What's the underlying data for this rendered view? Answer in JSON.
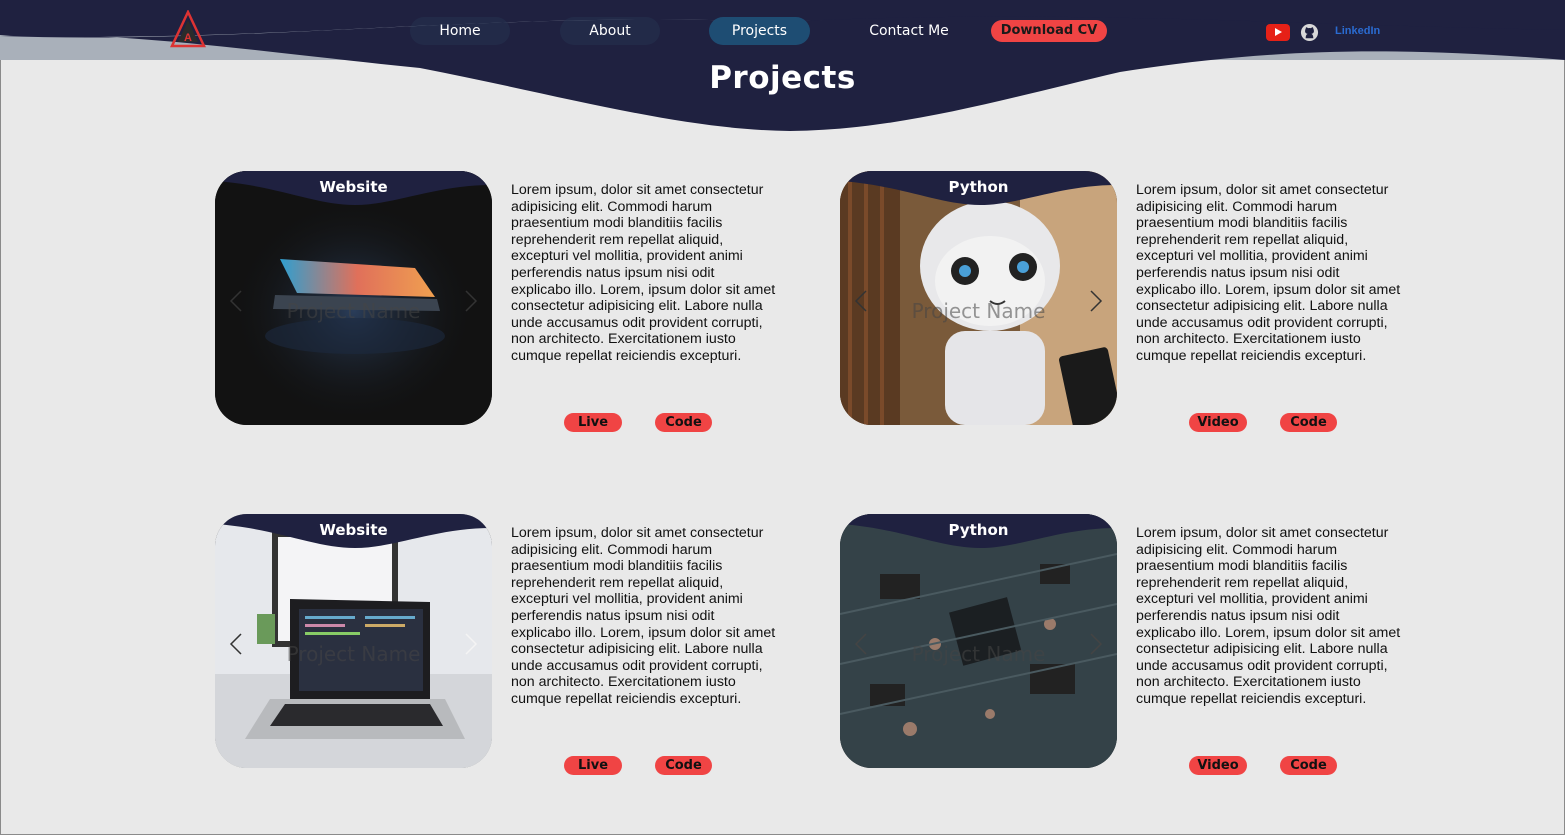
{
  "nav": {
    "items": [
      {
        "label": "Home"
      },
      {
        "label": "About"
      },
      {
        "label": "Projects"
      },
      {
        "label": "Contact Me"
      }
    ],
    "cv_label": "Download CV",
    "social": {
      "linkedin_label": "LinkedIn"
    }
  },
  "page": {
    "title": "Projects"
  },
  "projects": [
    {
      "category": "Website",
      "name": "Project Name",
      "description": "Lorem ipsum, dolor sit amet consectetur adipisicing elit. Commodi harum praesentium modi blanditiis facilis reprehenderit rem repellat aliquid, excepturi vel mollitia, provident animi perferendis natus ipsum nisi odit explicabo illo. Lorem, ipsum dolor sit amet consectetur adipisicing elit. Labore nulla unde accusamus odit provident corrupti, non architecto. Exercitationem iusto cumque repellat reiciendis excepturi.",
      "buttons": [
        "Live",
        "Code"
      ]
    },
    {
      "category": "Python",
      "name": "Project Name",
      "description": "Lorem ipsum, dolor sit amet consectetur adipisicing elit. Commodi harum praesentium modi blanditiis facilis reprehenderit rem repellat aliquid, excepturi vel mollitia, provident animi perferendis natus ipsum nisi odit explicabo illo. Lorem, ipsum dolor sit amet consectetur adipisicing elit. Labore nulla unde accusamus odit provident corrupti, non architecto. Exercitationem iusto cumque repellat reiciendis excepturi.",
      "buttons": [
        "Video",
        "Code"
      ]
    },
    {
      "category": "Website",
      "name": "Project Name",
      "description": "Lorem ipsum, dolor sit amet consectetur adipisicing elit. Commodi harum praesentium modi blanditiis facilis reprehenderit rem repellat aliquid, excepturi vel mollitia, provident animi perferendis natus ipsum nisi odit explicabo illo. Lorem, ipsum dolor sit amet consectetur adipisicing elit. Labore nulla unde accusamus odit provident corrupti, non architecto. Exercitationem iusto cumque repellat reiciendis excepturi.",
      "buttons": [
        "Live",
        "Code"
      ]
    },
    {
      "category": "Python",
      "name": "Project Name",
      "description": "Lorem ipsum, dolor sit amet consectetur adipisicing elit. Commodi harum praesentium modi blanditiis facilis reprehenderit rem repellat aliquid, excepturi vel mollitia, provident animi perferendis natus ipsum nisi odit explicabo illo. Lorem, ipsum dolor sit amet consectetur adipisicing elit. Labore nulla unde accusamus odit provident corrupti, non architecto. Exercitationem iusto cumque repellat reiciendis excepturi.",
      "buttons": [
        "Video",
        "Code"
      ]
    }
  ],
  "colors": {
    "header": "#1f2140",
    "accent_button": "#f04444",
    "active_nav": "#1e4d73",
    "background": "#e9e9e9"
  },
  "icons": [
    "logo-icon",
    "youtube-icon",
    "github-icon",
    "linkedin-icon",
    "chevron-left-icon",
    "chevron-right-icon"
  ]
}
